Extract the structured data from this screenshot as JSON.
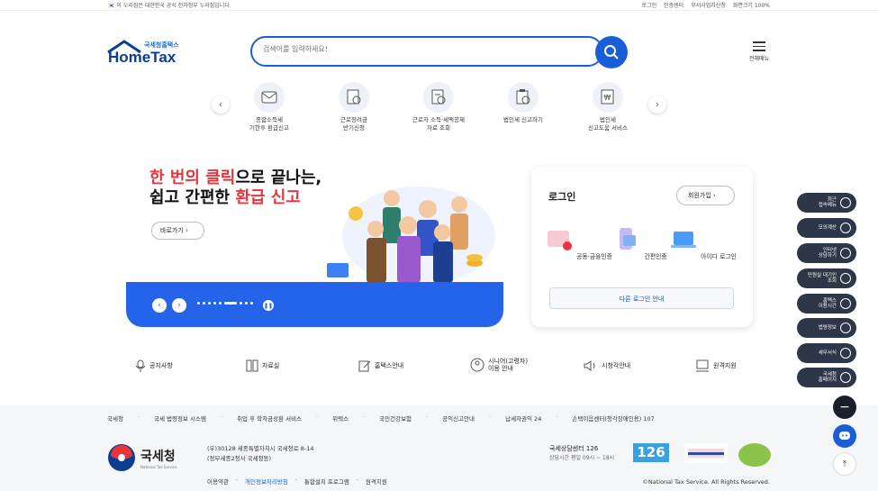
{
  "topbar": {
    "notice": "이 누리집은 대한민국 공식 전자정부 누리집입니다.",
    "links": [
      "로그인",
      "인증센터",
      "부서사업자신청",
      "화면크기 100%"
    ]
  },
  "logo": {
    "sub": "국세청홈택스",
    "main": "HomeTax"
  },
  "search": {
    "placeholder": "검색어를 입력하세요!"
  },
  "menu": {
    "label": "전체메뉴"
  },
  "quick": [
    {
      "label": "종합소득세\n기한후 환급신고",
      "icon": "tax-document-icon"
    },
    {
      "label": "근로장려금\n반기신청",
      "icon": "document-search-icon"
    },
    {
      "label": "근로자 소득·세액공제\n자료 조회",
      "icon": "receipt-search-icon"
    },
    {
      "label": "법인세 신고하기",
      "icon": "clipboard-search-icon"
    },
    {
      "label": "법인세\n신고도움 서비스",
      "icon": "won-document-icon"
    }
  ],
  "hero": {
    "line1_red": "한 번의 클릭",
    "line1_rest": "으로 끝나는,",
    "line2_a": "쉽고 간편한 ",
    "line2_red": "환급 신고",
    "more": "바로가기"
  },
  "login": {
    "title": "로그인",
    "join": "회원가입",
    "methods": [
      "공동·금융인증",
      "간편인증",
      "아이디 로그인"
    ],
    "other": "다른 로그인 안내"
  },
  "links": [
    "공지사항",
    "자료실",
    "홈택스안내",
    "시니어(고령자)\n이용 안내",
    "시청각안내",
    "원격지원"
  ],
  "footer": {
    "links": [
      "국세청",
      "국세 법령정보 시스템",
      "취업 후 학자금상환 서비스",
      "위택스",
      "국민건강보험",
      "공익신고안내",
      "납세자권익 24",
      "손택이음센터(청각장애인용) 107"
    ],
    "org": "국세청",
    "org_en": "National Tax Service",
    "address1": "(우)30128 세종특별자치시 국세청로 8-14",
    "address2": "(정부세종2청사 국세청동)",
    "bottom": [
      "이용약관",
      "개인정보처리방침",
      "통합설치 프로그램",
      "원격지원"
    ],
    "call": "국세상담센터 126",
    "hours": "상담시간 평일 09시 ~ 18시",
    "badge126": "126",
    "copyright": "©National Tax Service. All Rights Reserved."
  },
  "side": [
    "최근\n접속메뉴",
    "모의계산",
    "인터넷\n상담하기",
    "민원실 대기인\n조회",
    "홈택스\n이용시간",
    "법령정보",
    "세무서식",
    "국세청\n홈페이지"
  ],
  "colors": {
    "primary": "#1a5ed6",
    "accent_red": "#e8343d",
    "hero_bar": "#2563eb",
    "side": "#2d3748"
  }
}
